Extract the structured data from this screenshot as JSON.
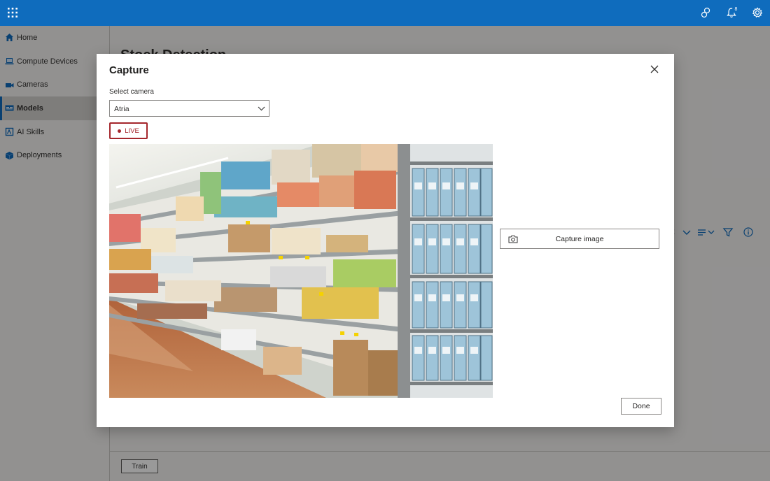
{
  "app": {
    "brand_color": "#0f6cbd",
    "notification_count": "8"
  },
  "sidebar": {
    "items": [
      {
        "label": "Home",
        "icon": "home-icon"
      },
      {
        "label": "Compute Devices",
        "icon": "laptop-icon"
      },
      {
        "label": "Cameras",
        "icon": "video-camera-icon"
      },
      {
        "label": "Models",
        "icon": "model-icon",
        "active": true
      },
      {
        "label": "AI Skills",
        "icon": "ai-skills-icon"
      },
      {
        "label": "Deployments",
        "icon": "cube-icon"
      }
    ]
  },
  "page": {
    "title": "Stock Detection",
    "sort_fragment": "t",
    "train_label": "Train"
  },
  "dialog": {
    "title": "Capture",
    "camera_label": "Select camera",
    "camera_value": "Atria",
    "live_label": "LIVE",
    "live_color": "#a4262c",
    "capture_label": "Capture image",
    "done_label": "Done"
  }
}
